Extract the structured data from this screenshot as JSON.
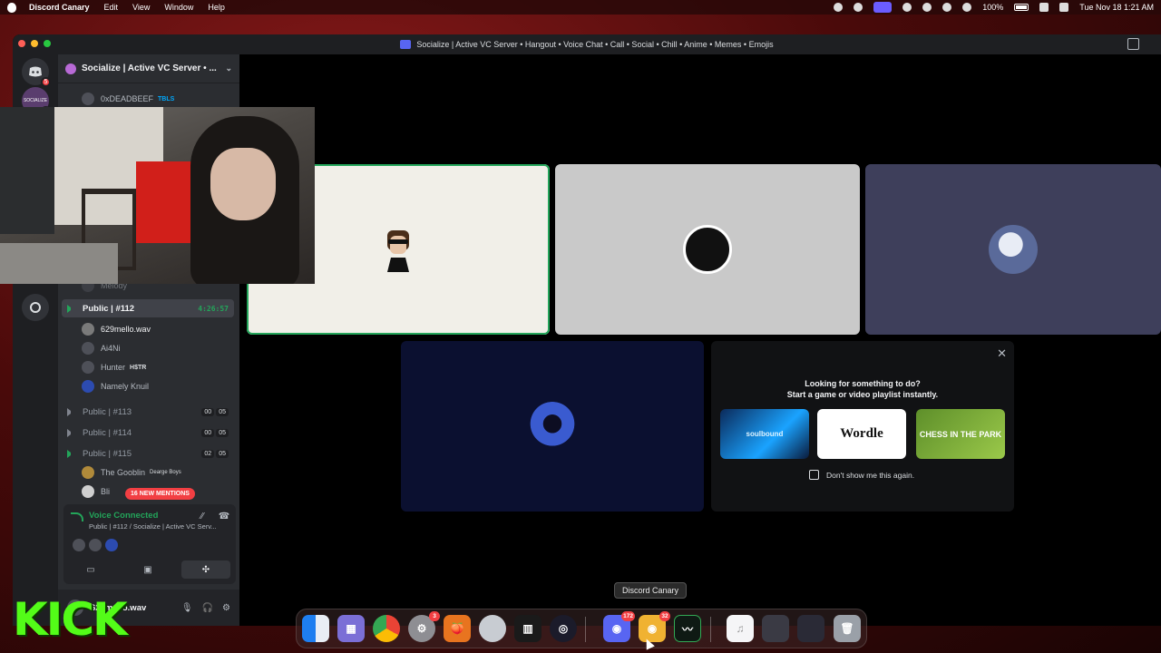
{
  "menubar": {
    "app": "Discord Canary",
    "items": [
      "Edit",
      "View",
      "Window",
      "Help"
    ],
    "battery": "100%",
    "datetime": "Tue Nov 18  1:21 AM"
  },
  "window": {
    "title": "Socialize | Active VC Server • Hangout • Voice Chat • Call • Social • Chill • Anime • Memes • Emojis"
  },
  "rail": {
    "home_badge": "5",
    "server_badge": "1",
    "server_label": "SOCIALIZE"
  },
  "sidebar": {
    "server_name": "Socialize | Active VC Server • ...",
    "top_members": [
      {
        "name": "0xDEADBEEF",
        "tag": "TBLS"
      }
    ],
    "partial_member": "Melody",
    "active_channel": {
      "name": "Public | #112",
      "timer": "4:26:57"
    },
    "channel_members": [
      {
        "name": "629mello.wav",
        "tag": ""
      },
      {
        "name": "Ai4Ni",
        "tag": ""
      },
      {
        "name": "Hunter",
        "tag": "H$TR"
      },
      {
        "name": "Namely Knuil",
        "tag": ""
      }
    ],
    "channels": [
      {
        "name": "Public | #113",
        "c1": "00",
        "c2": "05"
      },
      {
        "name": "Public | #114",
        "c1": "00",
        "c2": "05"
      },
      {
        "name": "Public | #115",
        "c1": "02",
        "c2": "05"
      }
    ],
    "bottom_members": [
      {
        "name": "The Gooblin",
        "tag": "Dearge Boys"
      },
      {
        "name": "Bli",
        "tag": ""
      }
    ],
    "mentions": "16 NEW MENTIONS"
  },
  "voice": {
    "status": "Voice Connected",
    "location": "Public | #112 / Socialize | Active VC Serv..."
  },
  "user": {
    "name": "629mello.wav"
  },
  "activity": {
    "line1": "Looking for something to do?",
    "line2": "Start a game or video playlist instantly.",
    "games": [
      "soulbound",
      "Wordle",
      "CHESS IN THE PARK"
    ],
    "checkbox_label": "Don't show me this again."
  },
  "tooltip": "Discord Canary",
  "dock": {
    "settings_badge": "3",
    "discord_badge": "172",
    "canary_badge": "32"
  },
  "overlay": {
    "kick": "KICK"
  },
  "colors": {
    "accent_green": "#23a55a",
    "discord_blurple": "#5865f2",
    "mention_red": "#f23f43",
    "kick_green": "#53fc18"
  }
}
